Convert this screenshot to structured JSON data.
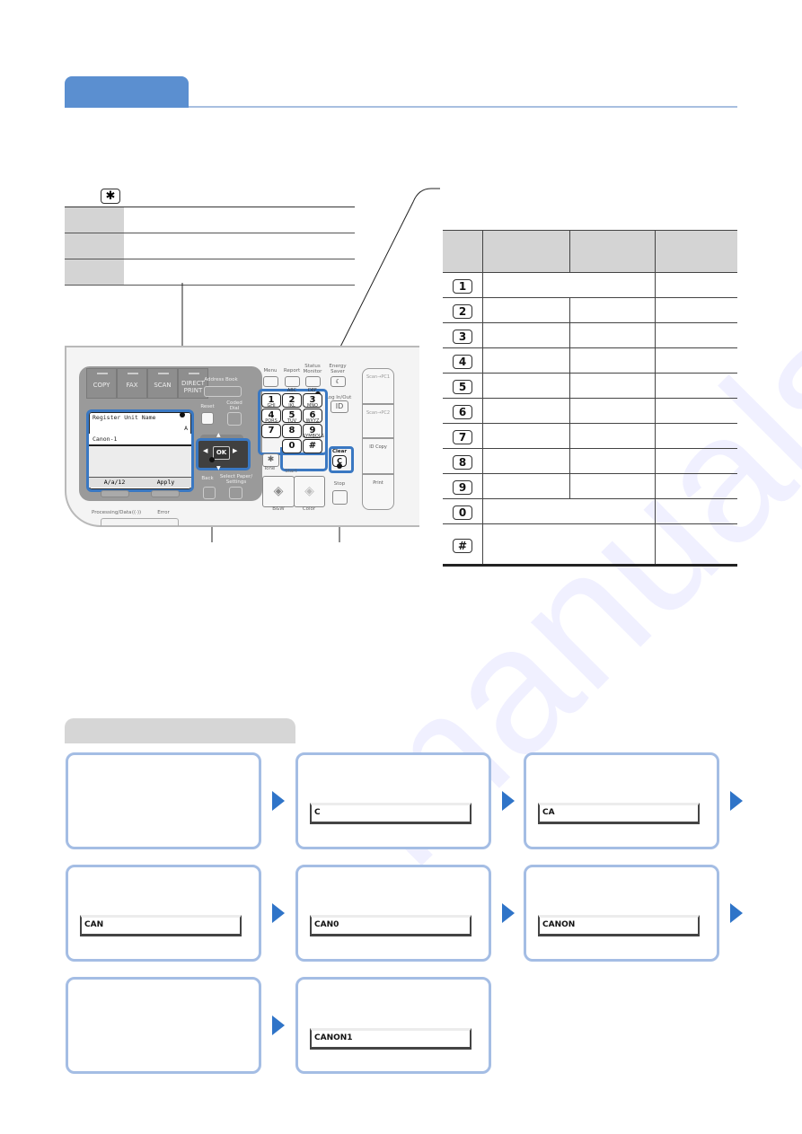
{
  "section": {
    "tab_label": "",
    "title": ""
  },
  "left_table": {
    "symbol_key": "✱",
    "rows": [
      {
        "head": "",
        "text": ""
      },
      {
        "head": "",
        "text": ""
      },
      {
        "head": "",
        "text": ""
      }
    ]
  },
  "control_panel": {
    "mode_keys": [
      "COPY",
      "FAX",
      "SCAN",
      "DIRECT PRINT"
    ],
    "address_book": "Address Book",
    "reset": "Reset",
    "coded_dial": "Coded Dial",
    "lcd": {
      "title": "Register Unit Name",
      "mode": "A",
      "value": "Canon-1",
      "left_soft": "A/a/12",
      "right_soft": "Apply"
    },
    "ok": "OK",
    "back": "Back",
    "select_paper": "Select Paper/ Settings",
    "menu": "Menu",
    "report": "Report",
    "status_monitor": "Status Monitor",
    "energy_saver": "Energy Saver",
    "login_out": "Log In/Out",
    "id": "ID",
    "numpad": [
      {
        "key": "1",
        "sub": ""
      },
      {
        "key": "2",
        "sub": "ABC"
      },
      {
        "key": "3",
        "sub": "DEF"
      },
      {
        "key": "4",
        "sub": "GHI"
      },
      {
        "key": "5",
        "sub": "JKL"
      },
      {
        "key": "6",
        "sub": "MNO"
      },
      {
        "key": "7",
        "sub": "PQRS"
      },
      {
        "key": "8",
        "sub": "TUV"
      },
      {
        "key": "9",
        "sub": "WXYZ"
      },
      {
        "key": "0",
        "sub": ""
      },
      {
        "key": "#",
        "sub": "SYMBOLS"
      }
    ],
    "star": "✱",
    "tone": "Tone",
    "clear": "Clear",
    "clear_key": "C",
    "start": "Start",
    "bw": "B&W",
    "color": "Color",
    "stop": "Stop",
    "right_buttons": [
      "Scan→PC1",
      "Scan→PC2",
      "ID Copy",
      "Print"
    ],
    "processing": "Processing/Data",
    "error": "Error"
  },
  "key_table": {
    "headers": [
      "",
      "",
      "",
      ""
    ],
    "rows": [
      {
        "key": "1",
        "merged": true
      },
      {
        "key": "2",
        "merged": false
      },
      {
        "key": "3",
        "merged": false
      },
      {
        "key": "4",
        "merged": false
      },
      {
        "key": "5",
        "merged": false
      },
      {
        "key": "6",
        "merged": false
      },
      {
        "key": "7",
        "merged": false
      },
      {
        "key": "8",
        "merged": false
      },
      {
        "key": "9",
        "merged": false
      },
      {
        "key": "0",
        "merged": true
      },
      {
        "key": "#",
        "merged": true
      }
    ]
  },
  "example": {
    "header": "",
    "steps": [
      {
        "field": null
      },
      {
        "field": "C"
      },
      {
        "field": "CA"
      },
      {
        "field": "CAN"
      },
      {
        "field": "CAN0"
      },
      {
        "field": "CANON"
      },
      {
        "field": null
      },
      {
        "field": "CANON1"
      }
    ]
  },
  "colors": {
    "accent": "#5b8fd0",
    "highlight": "#3a78c2",
    "arrow": "#2f74c8",
    "box_border": "#a4bde4"
  }
}
